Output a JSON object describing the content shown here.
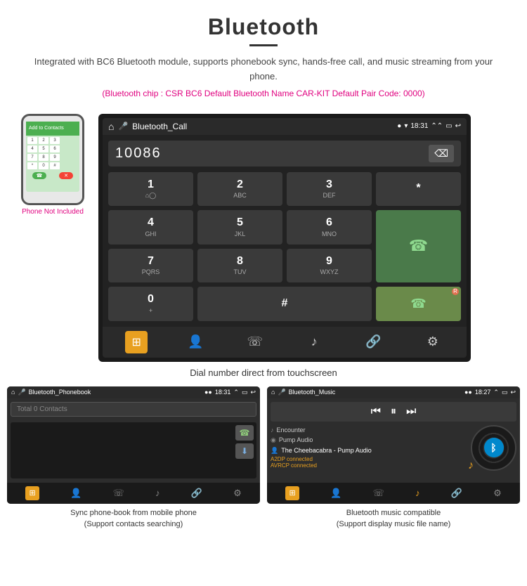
{
  "page": {
    "title": "Bluetooth",
    "description": "Integrated with BC6 Bluetooth module, supports phonebook sync, hands-free call, and music streaming from your phone.",
    "specs": "(Bluetooth chip : CSR BC6    Default Bluetooth Name CAR-KIT    Default Pair Code: 0000)"
  },
  "dialer": {
    "screen_title": "Bluetooth_Call",
    "time": "18:31",
    "input_number": "10086",
    "backspace_label": "⌫",
    "keys": [
      {
        "main": "1",
        "sub": "⌂◯"
      },
      {
        "main": "2",
        "sub": "ABC"
      },
      {
        "main": "3",
        "sub": "DEF"
      },
      {
        "main": "*",
        "sub": ""
      },
      {
        "main": "4",
        "sub": "GHI"
      },
      {
        "main": "5",
        "sub": "JKL"
      },
      {
        "main": "6",
        "sub": "MNO"
      },
      {
        "main": "0",
        "sub": "+"
      },
      {
        "main": "7",
        "sub": "PQRS"
      },
      {
        "main": "8",
        "sub": "TUV"
      },
      {
        "main": "9",
        "sub": "WXYZ"
      },
      {
        "main": "#",
        "sub": ""
      }
    ],
    "call_icon": "📞",
    "caption": "Dial number direct from touchscreen"
  },
  "phonebook": {
    "screen_title": "Bluetooth_Phonebook",
    "time": "18:31",
    "search_placeholder": "Total 0 Contacts",
    "caption_line1": "Sync phone-book from mobile phone",
    "caption_line2": "(Support contacts searching)"
  },
  "music": {
    "screen_title": "Bluetooth_Music",
    "time": "18:27",
    "tracks": [
      {
        "icon": "♪",
        "name": "Encounter"
      },
      {
        "icon": "◉",
        "name": "Pump Audio"
      },
      {
        "icon": "👤",
        "name": "The Cheebacabra - Pump Audio"
      }
    ],
    "connection_status": [
      "A2DP connected",
      "AVRCP connected"
    ],
    "caption_line1": "Bluetooth music compatible",
    "caption_line2": "(Support display music file name)"
  },
  "phone": {
    "not_included": "Phone Not Included"
  },
  "icons": {
    "home": "⌂",
    "bluetooth": "ᛒ",
    "phone_call": "☎",
    "keypad": "⊞",
    "contacts": "👤",
    "music_note": "♪",
    "link": "🔗",
    "settings": "⚙",
    "skip_back": "⏮",
    "pause": "⏸",
    "skip_fwd": "⏭"
  }
}
